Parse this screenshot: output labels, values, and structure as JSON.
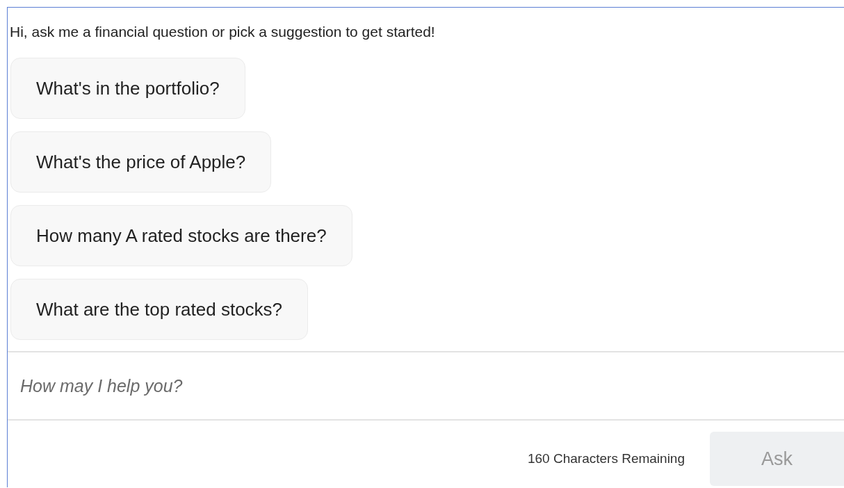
{
  "greeting": "Hi, ask me a financial question or pick a suggestion to get started!",
  "suggestions": [
    "What's in the portfolio?",
    "What's the price of Apple?",
    "How many A rated stocks are there?",
    "What are the top rated stocks?"
  ],
  "input": {
    "placeholder": "How may I help you?"
  },
  "counter": "160 Characters Remaining",
  "ask_button": {
    "label": "Ask",
    "disabled": true
  }
}
